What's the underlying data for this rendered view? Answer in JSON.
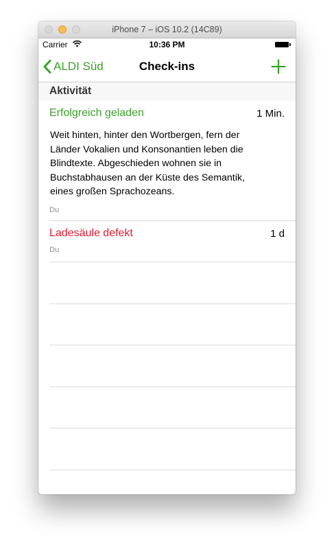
{
  "window": {
    "title": "iPhone 7 – iOS 10.2 (14C89)"
  },
  "status_bar": {
    "carrier": "Carrier",
    "time": "10:36 PM"
  },
  "nav": {
    "back_label": "ALDI Süd",
    "title": "Check-ins",
    "accent_color": "#3aa128"
  },
  "section": {
    "header": "Aktivität"
  },
  "checkins": [
    {
      "title": "Erfolgreich geladen",
      "title_color": "#3aa128",
      "time": "1 Min.",
      "body": "Weit hinten, hinter den Wortbergen, fern der Länder Vokalien und Konsonantien leben die Blindtexte. Abgeschieden wohnen sie in Buchstabhausen an der Küste des Semantik, eines großen Sprachozeans.",
      "author": "Du"
    },
    {
      "title": "Ladesäule defekt",
      "title_color": "#e5192e",
      "time": "1 d",
      "body": "",
      "author": "Du"
    }
  ]
}
